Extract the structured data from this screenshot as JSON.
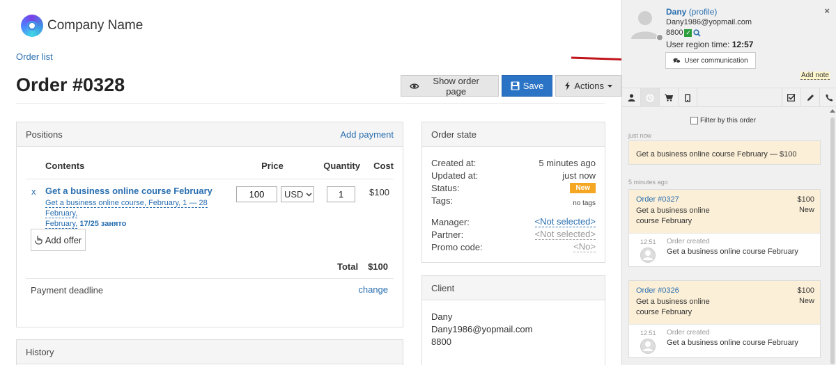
{
  "brand": {
    "name": "Company Name"
  },
  "breadcrumb": {
    "order_list": "Order list"
  },
  "order": {
    "title": "Order #0328"
  },
  "toolbar": {
    "show_order_page": "Show order page",
    "save": "Save",
    "actions": "Actions"
  },
  "positions": {
    "title": "Positions",
    "add_payment": "Add payment",
    "columns": {
      "contents": "Contents",
      "price": "Price",
      "quantity": "Quantity",
      "cost": "Cost"
    },
    "item": {
      "remove": "x",
      "name": "Get a business online course February",
      "desc_line1": "Get a business online course, February, 1 — 28 February,",
      "desc_line2": "February,",
      "desc_bold": "17/25 занято",
      "price": "100",
      "currency": "USD",
      "quantity": "1",
      "cost": "$100"
    },
    "add_offer": "Add offer",
    "total_label": "Total",
    "total_value": "$100",
    "payment_deadline": "Payment deadline",
    "change": "change"
  },
  "history": {
    "title": "History"
  },
  "order_state": {
    "title": "Order state",
    "created_label": "Created at:",
    "created_value": "5 minutes ago",
    "updated_label": "Updated at:",
    "updated_value": "just now",
    "status_label": "Status:",
    "status_value": "New",
    "status_color": "#f5a623",
    "tags_label": "Tags:",
    "tags_value": "no tags",
    "manager_label": "Manager:",
    "manager_value": "<Not selected>",
    "partner_label": "Partner:",
    "partner_value": "<Not selected>",
    "promo_label": "Promo code:",
    "promo_value": "<No>"
  },
  "client": {
    "title": "Client",
    "name": "Dany",
    "email": "Dany1986@yopmail.com",
    "phone": "8800"
  },
  "sidebar": {
    "user_name": "Dany",
    "profile_link": "(profile)",
    "email": "Dany1986@yopmail.com",
    "phone": "8800",
    "region_time_label": "User region time:",
    "region_time_value": "12:57",
    "user_communication": "User communication",
    "add_note": "Add note",
    "close": "×",
    "filter_label": "Filter by this order",
    "just_now": "just now",
    "recent_event": "Get a business online course February — $100",
    "five_min_ago": "5 minutes ago",
    "orders": [
      {
        "number": "Order #0327",
        "price": "$100",
        "title": "Get a business online course February",
        "status": "New",
        "event_time": "12:51",
        "event_label": "Order created",
        "event_text": "Get a business online course February"
      },
      {
        "number": "Order #0326",
        "price": "$100",
        "title": "Get a business online course February",
        "status": "New",
        "event_time": "12:51",
        "event_label": "Order created",
        "event_text": "Get a business online course February"
      }
    ],
    "icons": {
      "tabs_left": [
        "user-icon",
        "history-icon",
        "cart-icon",
        "mobile-icon"
      ],
      "tabs_right": [
        "checklist-icon",
        "pencil-icon",
        "phone-icon"
      ]
    }
  },
  "colors": {
    "accent": "#2a73c5",
    "link": "#2a6fb0",
    "status_new": "#f5a623",
    "highlight": "#fcefd7",
    "arrow": "#c0141b"
  }
}
